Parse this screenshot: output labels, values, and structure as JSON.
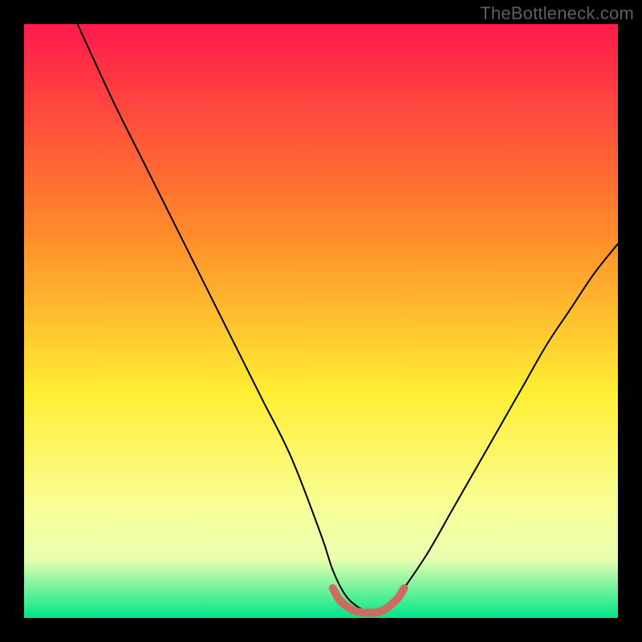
{
  "watermark": "TheBottleneck.com",
  "colors": {
    "frame": "#000000",
    "gradient_top": "#ff1a4b",
    "gradient_mid1": "#ff8a2a",
    "gradient_mid2": "#ffee33",
    "gradient_low": "#f8ff9a",
    "gradient_band": "#e8ffb0",
    "gradient_bottom": "#00e58a",
    "curve": "#000000",
    "valley_marker": "#cc6b60"
  },
  "chart_data": {
    "type": "line",
    "title": "",
    "xlabel": "",
    "ylabel": "",
    "xlim": [
      0,
      100
    ],
    "ylim": [
      0,
      100
    ],
    "series": [
      {
        "name": "bottleneck-curve",
        "x": [
          9,
          15,
          20,
          25,
          30,
          35,
          40,
          45,
          50,
          52,
          54,
          56,
          58,
          60,
          62,
          64,
          68,
          72,
          76,
          80,
          84,
          88,
          92,
          96,
          100
        ],
        "values": [
          100,
          87,
          77,
          67,
          57,
          47,
          37,
          27,
          14,
          8,
          4,
          2,
          1,
          1,
          2,
          5,
          11,
          18,
          25,
          32,
          39,
          46,
          52,
          58,
          63
        ]
      },
      {
        "name": "valley-marker",
        "x": [
          52,
          53,
          54,
          55,
          56,
          57,
          58,
          59,
          60,
          61,
          62,
          63,
          64
        ],
        "values": [
          5,
          3.2,
          2.2,
          1.5,
          1.1,
          0.9,
          0.9,
          0.9,
          1.1,
          1.6,
          2.4,
          3.4,
          5
        ]
      }
    ],
    "gradient_stops_pct": [
      {
        "offset": 0,
        "color": "#ff1a4b"
      },
      {
        "offset": 35,
        "color": "#ff8a2a"
      },
      {
        "offset": 62,
        "color": "#ffee33"
      },
      {
        "offset": 82,
        "color": "#f8ff9a"
      },
      {
        "offset": 90,
        "color": "#e8ffb0"
      },
      {
        "offset": 100,
        "color": "#00e58a"
      }
    ]
  }
}
